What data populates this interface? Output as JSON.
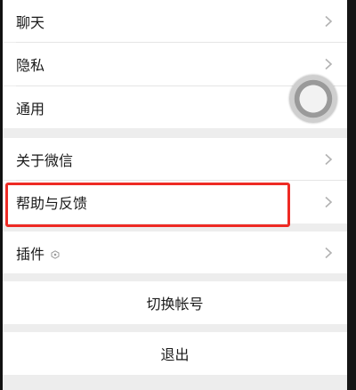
{
  "settings": {
    "items": [
      {
        "label": "聊天"
      },
      {
        "label": "隐私"
      },
      {
        "label": "通用"
      },
      {
        "label": "关于微信"
      },
      {
        "label": "帮助与反馈"
      },
      {
        "label": "插件"
      }
    ],
    "switch_account_label": "切换帐号",
    "logout_label": "退出"
  },
  "icons": {
    "chevron": "chevron-right-icon",
    "plugin": "hexagon-icon",
    "assistive_touch": "assistive-touch-icon"
  },
  "colors": {
    "highlight": "#ee2a24",
    "background": "#ededed",
    "row": "#ffffff",
    "text": "#1a1a1a",
    "chevron": "#b2b2b2"
  }
}
